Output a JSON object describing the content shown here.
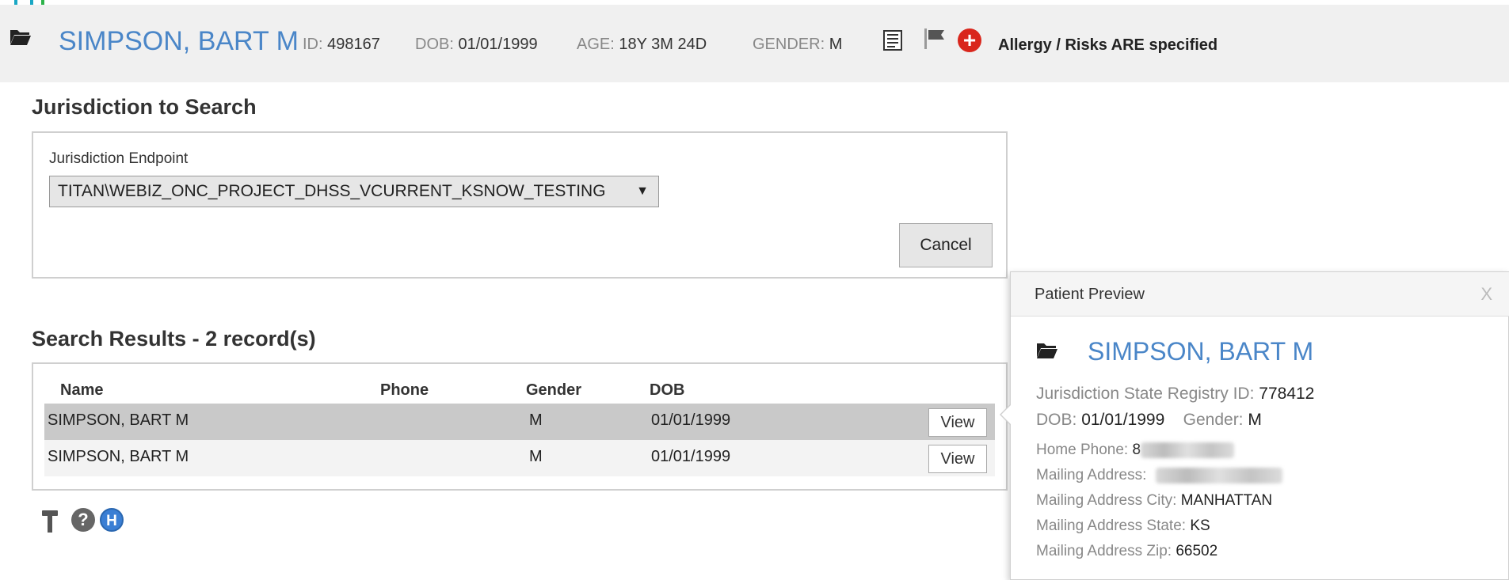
{
  "colors": {
    "accent_teal": "#1aa7c4",
    "accent_green": "#2db34a",
    "link_blue": "#4a86c8",
    "alert_red": "#d9261c"
  },
  "header": {
    "icon": "folder-open-icon",
    "patient_name": "SIMPSON, BART M",
    "id_label": "ID:",
    "id_value": "498167",
    "dob_label": "DOB:",
    "dob_value": "01/01/1999",
    "age_label": "AGE:",
    "age_value": "18Y 3M 24D",
    "gender_label": "GENDER:",
    "gender_value": "M",
    "icons": [
      "document-icon",
      "flag-icon",
      "plus-circle-icon"
    ],
    "allergy_text": "Allergy / Risks ARE specified"
  },
  "jurisdiction": {
    "section_title": "Jurisdiction to Search",
    "endpoint_label": "Jurisdiction Endpoint",
    "endpoint_value": "TITAN\\WEBIZ_ONC_PROJECT_DHSS_VCURRENT_KSNOW_TESTING",
    "caret": "▼",
    "cancel_label": "Cancel"
  },
  "results": {
    "section_title": "Search Results - 2 record(s)",
    "columns": [
      "Name",
      "Phone",
      "Gender",
      "DOB"
    ],
    "rows": [
      {
        "name": "SIMPSON, BART M",
        "phone": "",
        "gender": "M",
        "dob": "01/01/1999",
        "action": "View"
      },
      {
        "name": "SIMPSON, BART M",
        "phone": "",
        "gender": "M",
        "dob": "01/01/1999",
        "action": "View"
      }
    ]
  },
  "tools": {
    "icons": [
      "hammer-icon",
      "help-icon",
      "h-icon"
    ],
    "help_glyph": "?",
    "h_glyph": "H"
  },
  "preview": {
    "title": "Patient Preview",
    "close": "X",
    "patient_name": "SIMPSON, BART M",
    "registry_label": "Jurisdiction State Registry ID:",
    "registry_value": "778412",
    "dob_label": "DOB:",
    "dob_value": "01/01/1999",
    "gender_label": "Gender:",
    "gender_value": "M",
    "home_phone_label": "Home Phone:",
    "home_phone_value": "8",
    "mailing_address_label": "Mailing Address:",
    "city_label": "Mailing Address City:",
    "city_value": "MANHATTAN",
    "state_label": "Mailing Address State:",
    "state_value": "KS",
    "zip_label": "Mailing Address Zip:",
    "zip_value": "66502"
  }
}
